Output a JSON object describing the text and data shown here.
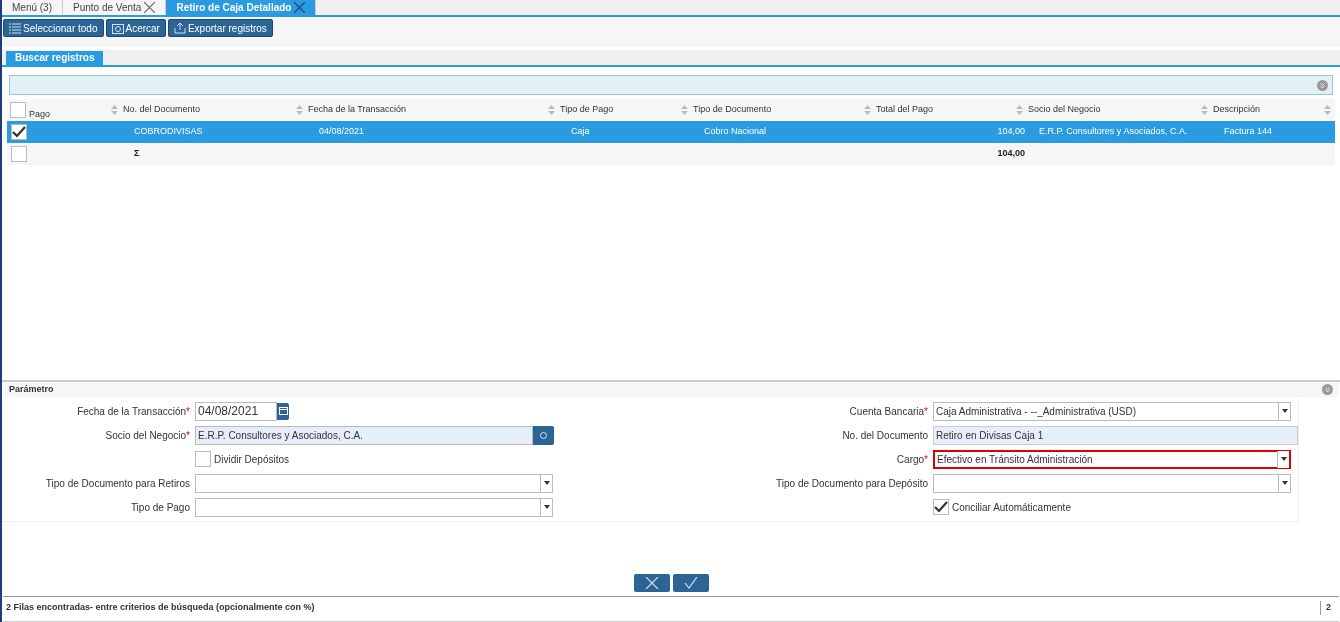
{
  "tabs": [
    {
      "label": "Menú (3)",
      "closable": false,
      "selected": false
    },
    {
      "label": "Punto de Venta",
      "closable": true,
      "selected": false
    },
    {
      "label": "Retiro de Caja Detallado",
      "closable": true,
      "selected": true
    }
  ],
  "toolbar": [
    {
      "kind": "select_all",
      "label": "Seleccionar todo"
    },
    {
      "kind": "zoom",
      "label": "Acercar"
    },
    {
      "kind": "export",
      "label": "Exportar registros"
    }
  ],
  "search_tab": {
    "label": "Buscar registros"
  },
  "table": {
    "columns": [
      {
        "label": "Pago"
      },
      {
        "label": "No. del Documento"
      },
      {
        "label": "Fecha de la Transacción"
      },
      {
        "label": "Tipo de Pago"
      },
      {
        "label": "Tipo de Documento"
      },
      {
        "label": "Total del Pago"
      },
      {
        "label": "Socio del Negocio"
      },
      {
        "label": "Descripción"
      }
    ],
    "header_checked": false,
    "rows": [
      {
        "kind": "data",
        "selected": true,
        "checked": true,
        "cells": [
          "COBRODIVISAS",
          "04/08/2021",
          "Caja",
          "Cobro Nacional",
          "104,00",
          "E.R.P. Consultores y Asociados, C.A.",
          "Factura 144"
        ]
      },
      {
        "kind": "total",
        "selected": false,
        "checked": false,
        "sum_label": "Σ",
        "total": "104,00"
      }
    ]
  },
  "parameters": {
    "title": "Parámetro",
    "left": [
      {
        "kind": "date",
        "label": "Fecha de la Transacción",
        "required_mark": "*",
        "value": "04/08/2021"
      },
      {
        "kind": "search",
        "label": "Socio del Negocio",
        "required_mark": "*",
        "value": "E.R.P. Consultores y Asociados, C.A."
      },
      {
        "kind": "checkbox",
        "label": "Dividir Depósitos",
        "checked": false
      },
      {
        "kind": "select",
        "label": "Tipo de Documento para Retiros",
        "highlighted": false
      },
      {
        "kind": "select",
        "label": "Tipo de Pago",
        "highlighted": false
      }
    ],
    "right": [
      {
        "kind": "select",
        "label": "Cuenta Bancaria",
        "required_mark": "*",
        "value": "Caja Administrativa - --_Administrativa (USD)",
        "highlighted": false
      },
      {
        "kind": "text",
        "label": "No. del Documento",
        "value": "Retiro en Divisas Caja 1"
      },
      {
        "kind": "select",
        "label": "Cargo",
        "required_mark": "*",
        "value": "Efectivo en Tránsito Administración",
        "highlighted": true
      },
      {
        "kind": "select",
        "label": "Tipo de Documento para Depósito",
        "highlighted": false
      },
      {
        "kind": "checkbox",
        "label": "Conciliar Automáticamente",
        "checked": true
      }
    ]
  },
  "actions": [
    {
      "kind": "cancel"
    },
    {
      "kind": "ok"
    }
  ],
  "status_bar": {
    "message": "2 Filas encontradas- entre criterios de búsqueda (opcionalmente con %)",
    "count": "2"
  }
}
